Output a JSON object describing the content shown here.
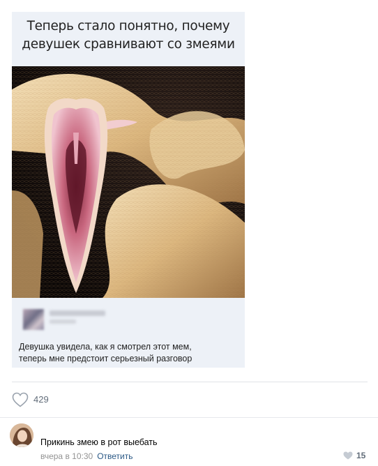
{
  "meme": {
    "title_line1": "Теперь стало понятно, почему",
    "title_line2": "девушек сравнивают со змеями",
    "inner_post": {
      "text_line1": "Девушка увидела, как я смотрел этот мем,",
      "text_line2": "теперь мне предстоит серьезный разговор"
    }
  },
  "post": {
    "like_count": "429"
  },
  "comment": {
    "text": "Прикинь змею в рот выебать",
    "time": "вчера в 10:30",
    "reply_label": "Ответить",
    "like_count": "15"
  },
  "icons": {
    "like": "heart-icon",
    "comment_like": "heart-icon"
  },
  "colors": {
    "link": "#2a5885",
    "meta": "#939393",
    "card_bg": "#edf1f7"
  }
}
